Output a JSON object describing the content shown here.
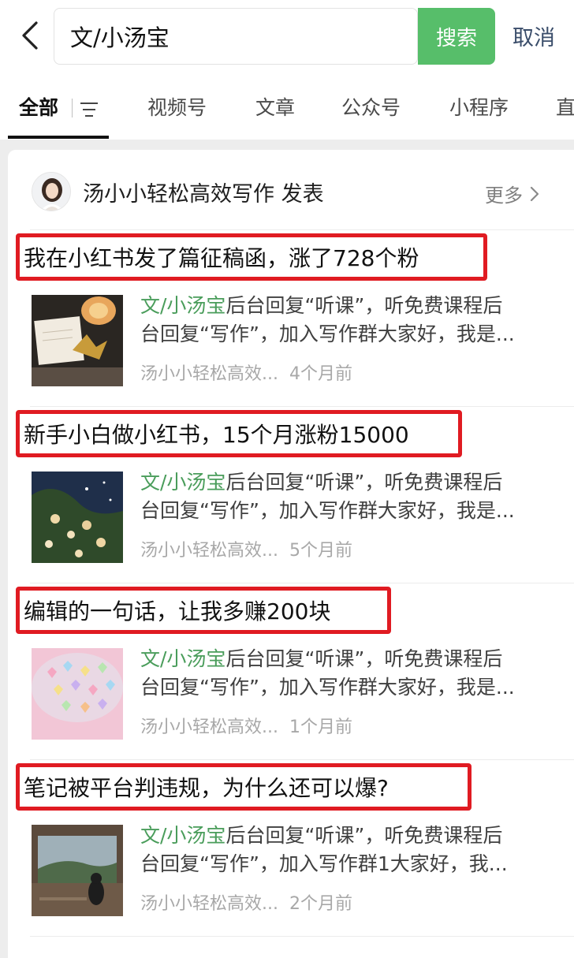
{
  "search": {
    "back_icon": "chevron-left-icon",
    "query": "文/小汤宝",
    "clear_icon": "clear-circle-icon",
    "button_label": "搜索",
    "cancel_label": "取消"
  },
  "tabs": {
    "items": [
      {
        "label": "全部",
        "active": true
      },
      {
        "label": "视频号"
      },
      {
        "label": "文章"
      },
      {
        "label": "公众号"
      },
      {
        "label": "小程序"
      },
      {
        "label": "直"
      }
    ],
    "filter_icon": "filter-icon"
  },
  "card": {
    "publisher": "汤小小轻松高效写作 发表",
    "more_label": "更多",
    "more_icon": "chevron-right-icon"
  },
  "articles": [
    {
      "title": "我在小红书发了篇征稿函，涨了728个粉",
      "snippet_highlight": "文/小汤宝",
      "snippet_rest": "后台回复“听课”，听免费课程后",
      "snippet_line2": "台回复“写作”，加入写作群大家好，我是...",
      "author": "汤小小轻松高效...",
      "time": "4个月前"
    },
    {
      "title": "新手小白做小红书，15个月涨粉15000",
      "snippet_highlight": "文/小汤宝",
      "snippet_rest": "后台回复“听课”，听免费课程后",
      "snippet_line2": "台回复“写作”，加入写作群大家好，我是...",
      "author": "汤小小轻松高效...",
      "time": "5个月前"
    },
    {
      "title": "编辑的一句话，让我多赚200块",
      "snippet_highlight": "文/小汤宝",
      "snippet_rest": "后台回复“听课”，听免费课程后",
      "snippet_line2": "台回复“写作”，加入写作群大家好，我是...",
      "author": "汤小小轻松高效...",
      "time": "1个月前"
    },
    {
      "title": "笔记被平台判违规，为什么还可以爆?",
      "snippet_highlight": "文/小汤宝",
      "snippet_rest": "后台回复“听课”，听免费课程后",
      "snippet_line2": "台回复“写作”，加入写作群1大家好，我...",
      "author": "汤小小轻松高效...",
      "time": "2个月前"
    }
  ],
  "colors": {
    "accent_green": "#57be6a",
    "highlight_green": "#4a9d5b",
    "annotation_red": "#e01b22",
    "cancel_blue": "#3a4d6a"
  }
}
